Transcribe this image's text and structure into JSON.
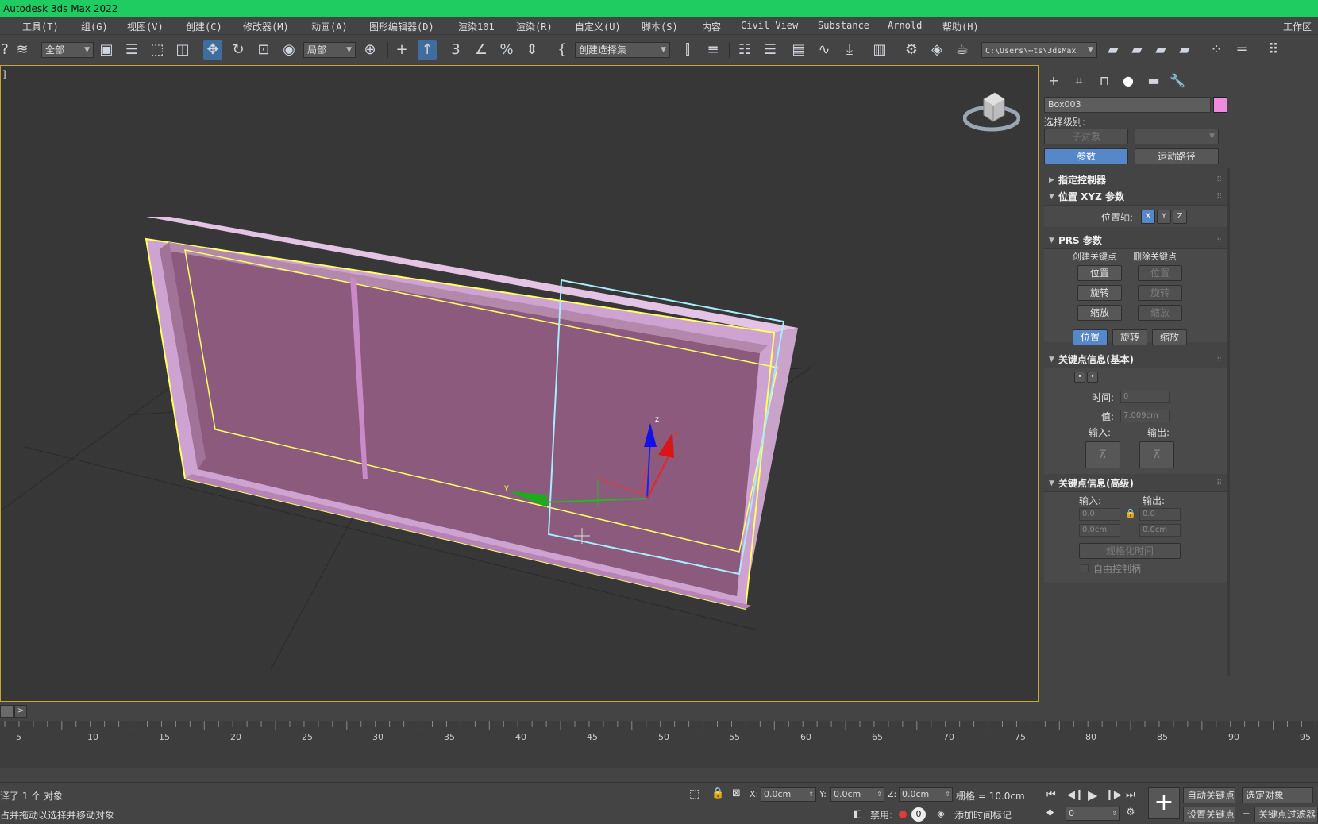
{
  "app": {
    "title": "Autodesk 3ds Max 2022",
    "accent": "#1fcc62"
  },
  "menu": {
    "items": [
      "工具(T)",
      "组(G)",
      "视图(V)",
      "创建(C)",
      "修改器(M)",
      "动画(A)",
      "图形编辑器(D)",
      "渲染101",
      "渲染(R)",
      "自定义(U)",
      "脚本(S)",
      "内容",
      "Civil View",
      "Substance",
      "Arnold",
      "帮助(H)"
    ],
    "workspace": "工作区"
  },
  "toolbar": {
    "filter_value": "全部",
    "coord_value": "局部",
    "selection_set": "创建选择集",
    "path": "C:\\Users\\⋯ts\\3dsMax",
    "icons": [
      "undo-icon",
      "bind-icon",
      "select-object-icon",
      "select-by-name-icon",
      "rect-region-icon",
      "window-crossing-icon",
      "move-icon",
      "rotate-icon",
      "scale-icon",
      "placement-icon",
      "pivot-icon",
      "snap-3d-icon",
      "angle-snap-icon",
      "percent-snap-icon",
      "spinner-snap-icon",
      "mirror-icon",
      "align-icon",
      "scene-explorer-icon",
      "layer-icon",
      "ribbon-icon",
      "curve-editor-icon",
      "schematic-icon",
      "material-editor-icon",
      "render-setup-icon",
      "render-frame-icon",
      "render-icon"
    ]
  },
  "viewport": {
    "label": "]",
    "object_color": "#ef8bde",
    "selection_color": "#ffff66"
  },
  "command_panel": {
    "object_name": "Box003",
    "object_color": "#ef8bde",
    "selection_level_label": "选择级别:",
    "sub_object_btn": "子对象",
    "params_btn": "参数",
    "motion_path_btn": "运动路径",
    "assign_controller": "指定控制器",
    "position_xyz": "位置 XYZ 参数",
    "position_axis_label": "位置轴:",
    "axes": [
      "X",
      "Y",
      "Z"
    ],
    "prs": "PRS 参数",
    "create_key_label": "创建关键点",
    "delete_key_label": "删除关键点",
    "pos": "位置",
    "rot": "旋转",
    "scl": "缩放",
    "key_info_basic": "关键点信息(基本)",
    "time_label": "时间:",
    "time_value": "0",
    "value_label": "值:",
    "value_value": "7.009cm",
    "in_label": "输入:",
    "out_label": "输出:",
    "key_info_adv": "关键点信息(高级)",
    "adv_in_label": "输入:",
    "adv_out_label": "输出:",
    "adv_in1": "0.0",
    "adv_out1": "0.0",
    "adv_in2": "0.0cm",
    "adv_out2": "0.0cm",
    "normalize_time": "规格化时间",
    "free_handle": "自由控制柄"
  },
  "timeline": {
    "next_btn": ">",
    "ticks": [
      "5",
      "10",
      "15",
      "20",
      "25",
      "30",
      "35",
      "40",
      "45",
      "50",
      "55",
      "60",
      "65",
      "70",
      "75",
      "80",
      "85",
      "90",
      "95"
    ]
  },
  "status": {
    "selected": "译了 1 个 对象",
    "prompt": "占并拖动以选择并移动对象",
    "x_label": "X:",
    "x_value": "0.0cm",
    "y_label": "Y:",
    "y_value": "0.0cm",
    "z_label": "Z:",
    "z_value": "0.0cm",
    "grid": "栅格 = 10.0cm",
    "disabled": "禁用:",
    "counter": "0",
    "add_time_tag": "添加时间标记",
    "auto_key": "自动关键点",
    "set_key": "设置关键点",
    "selected_obj": "选定对象",
    "key_filters": "关键点过滤器",
    "frame_value": "0"
  }
}
